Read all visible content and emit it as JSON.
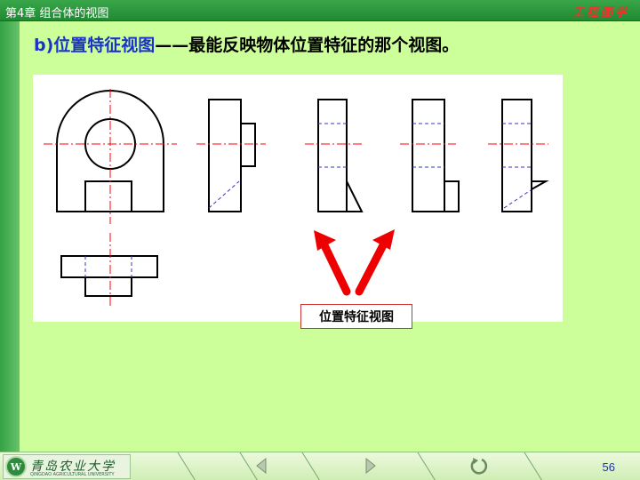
{
  "header": {
    "chapter": "第4章  组合体的视图",
    "course": "工程图学"
  },
  "heading": {
    "term": "b)位置特征视图",
    "desc": "——最能反映物体位置特征的那个视图。"
  },
  "callout": "位置特征视图",
  "footer": {
    "university_name": "青岛农业大学",
    "university_en": "QINGDAO AGRICULTURAL UNIVERSITY",
    "logo_letter": "W",
    "page_number": "56"
  },
  "colors": {
    "background": "#ccff99",
    "heading_term": "#1a33cc",
    "center_line": "#ff0000",
    "hidden_line": "#3333cc",
    "arrow": "#ee0000"
  },
  "icons": {
    "prev": "triangle-left-icon",
    "next": "triangle-right-icon",
    "return": "return-circle-icon"
  }
}
